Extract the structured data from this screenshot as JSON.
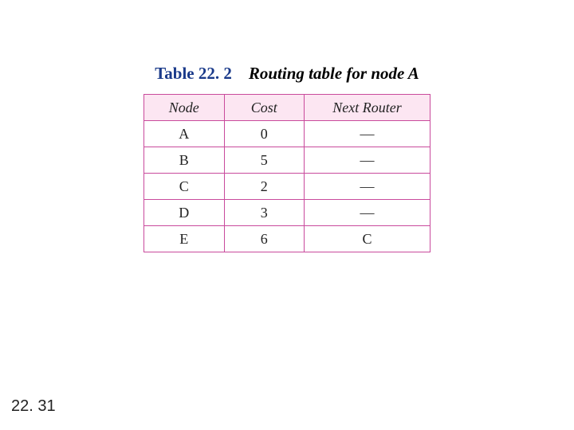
{
  "caption": {
    "label": "Table 22. 2",
    "title": "Routing table for node A"
  },
  "table": {
    "headers": {
      "node": "Node",
      "cost": "Cost",
      "next": "Next Router"
    },
    "rows": [
      {
        "node": "A",
        "cost": "0",
        "next": "—"
      },
      {
        "node": "B",
        "cost": "5",
        "next": "—"
      },
      {
        "node": "C",
        "cost": "2",
        "next": "—"
      },
      {
        "node": "D",
        "cost": "3",
        "next": "—"
      },
      {
        "node": "E",
        "cost": "6",
        "next": "C"
      }
    ]
  },
  "page_number": "22. 31",
  "chart_data": {
    "type": "table",
    "title": "Table 22.2 Routing table for node A",
    "columns": [
      "Node",
      "Cost",
      "Next Router"
    ],
    "rows": [
      [
        "A",
        0,
        "—"
      ],
      [
        "B",
        5,
        "—"
      ],
      [
        "C",
        2,
        "—"
      ],
      [
        "D",
        3,
        "—"
      ],
      [
        "E",
        6,
        "C"
      ]
    ]
  }
}
